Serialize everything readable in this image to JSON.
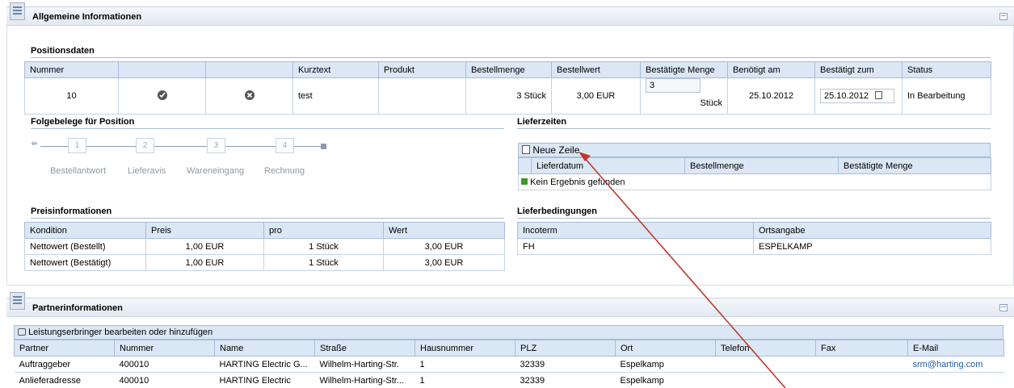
{
  "general": {
    "title": "Allgemeine Informationen"
  },
  "positions": {
    "title": "Positionsdaten",
    "headers": [
      "Nummer",
      "",
      "",
      "Kurztext",
      "Produkt",
      "Bestellmenge",
      "Bestellwert",
      "Bestätigte Menge",
      "Benötigt am",
      "Bestätigt zum",
      "Status"
    ],
    "row": {
      "nummer": "10",
      "kurztext": "test",
      "produkt": "",
      "bestellmenge": "3 Stück",
      "bestellwert": "3,00 EUR",
      "bestaetigt_menge": "3",
      "bestaetigt_unit": "Stück",
      "benoetigt": "25.10.2012",
      "bestaetigt_zum": "25.10.2012",
      "status": "In Bearbeitung"
    }
  },
  "folge": {
    "title": "Folgebelege für Position",
    "steps": [
      "1",
      "2",
      "3",
      "4"
    ],
    "labels": [
      "Bestellantwort",
      "Lieferavis",
      "Wareneingang",
      "Rechnung"
    ]
  },
  "lieferzeiten": {
    "title": "Lieferzeiten",
    "new_row": "Neue Zeile",
    "headers": [
      "Lieferdatum",
      "Bestellmenge",
      "Bestätigte Menge"
    ],
    "empty": "Kein Ergebnis gefunden"
  },
  "preis": {
    "title": "Preisinformationen",
    "headers": [
      "Kondition",
      "Preis",
      "pro",
      "Wert"
    ],
    "rows": [
      [
        "Nettowert (Bestellt)",
        "1,00 EUR",
        "1 Stück",
        "3,00 EUR"
      ],
      [
        "Nettowert (Bestätigt)",
        "1,00 EUR",
        "1 Stück",
        "3,00 EUR"
      ]
    ]
  },
  "liefer_bed": {
    "title": "Lieferbedingungen",
    "headers": [
      "Incoterm",
      "Ortsangabe"
    ],
    "row": [
      "FH",
      "ESPELKAMP"
    ]
  },
  "partner": {
    "title": "Partnerinformationen",
    "edit": "Leistungserbringer bearbeiten oder hinzufügen",
    "headers": [
      "Partner",
      "Nummer",
      "Name",
      "Straße",
      "Hausnummer",
      "PLZ",
      "Ort",
      "Telefon",
      "Fax",
      "E-Mail"
    ],
    "rows": [
      [
        "Auftraggeber",
        "400010",
        "HARTING Electric G...",
        "Wilhelm-Harting-Str.",
        "1",
        "32339",
        "Espelkamp",
        "",
        "",
        "srm@harting.com"
      ],
      [
        "Anlieferadresse",
        "400010",
        "HARTING Electric",
        "Wilhelm-Harting-Str...",
        "1",
        "32339",
        "Espelkamp",
        "",
        "",
        ""
      ]
    ]
  }
}
